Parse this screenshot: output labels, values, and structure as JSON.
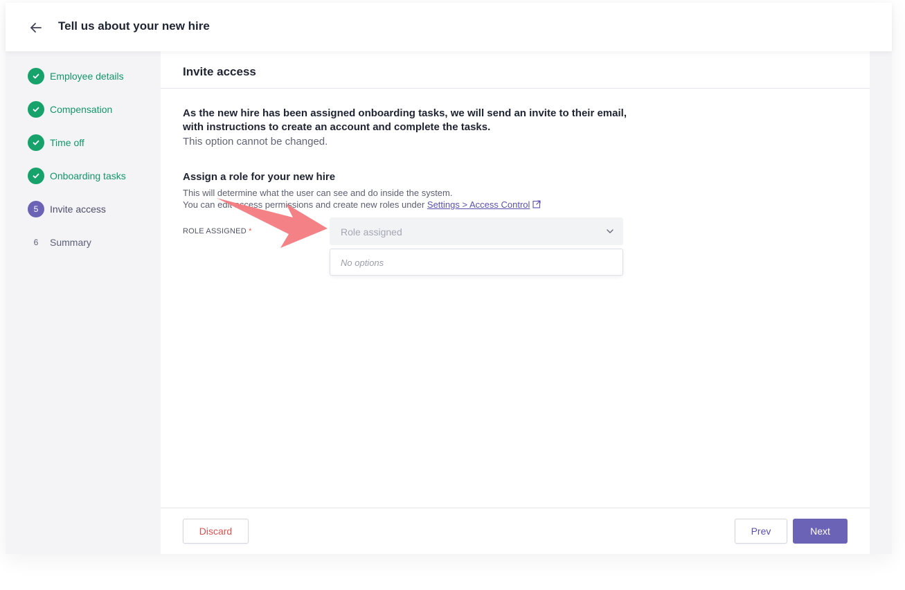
{
  "header": {
    "title": "Tell us about your new hire",
    "back_icon": "arrow-left-icon"
  },
  "steps": [
    {
      "label": "Employee details",
      "status": "done"
    },
    {
      "label": "Compensation",
      "status": "done"
    },
    {
      "label": "Time off",
      "status": "done"
    },
    {
      "label": "Onboarding tasks",
      "status": "done"
    },
    {
      "label": "Invite access",
      "status": "current",
      "number": "5"
    },
    {
      "label": "Summary",
      "status": "upcoming",
      "number": "6"
    }
  ],
  "panel": {
    "title": "Invite access",
    "intro_line1": "As the new hire has been assigned onboarding tasks, we will send an invite to their email,",
    "intro_line2": "with instructions to create an account and complete the tasks.",
    "intro_sub": "This option cannot be changed.",
    "assign_title": "Assign a role for your new hire",
    "assign_desc_line1": "This will determine what the user can see and do inside the system.",
    "assign_desc_line2": "You can edit access permissions and create new roles under",
    "settings_link": "Settings > Access Control",
    "field_label": "ROLE ASSIGNED",
    "required_mark": "*",
    "select_placeholder": "Role assigned",
    "dropdown_empty": "No options"
  },
  "footer": {
    "discard": "Discard",
    "prev": "Prev",
    "next": "Next"
  },
  "colors": {
    "success": "#18a26b",
    "accent": "#6b63b5",
    "danger": "#d9534f",
    "annotation": "#f27c80"
  }
}
